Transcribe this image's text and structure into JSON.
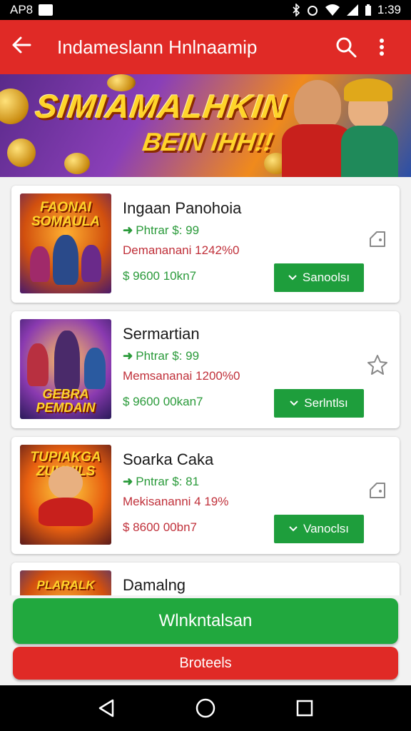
{
  "status_bar": {
    "carrier": "AP8",
    "time": "1:39"
  },
  "app_bar": {
    "title": "Indameslann Hnlnaamip"
  },
  "banner": {
    "headline": "SIMIAMALHKIN",
    "subline": "BEIN IHH!!"
  },
  "cards": [
    {
      "thumb_title": "FAONAI SOMAULA",
      "name": "Ingaan Panohoia",
      "price": "Phtrar $: 99",
      "demand": "Demananani 1242%0",
      "stock": "$ 9600 10kn7",
      "button_label": "Sanoolsı"
    },
    {
      "thumb_title": "GEBRA PEMDAIN",
      "name": "Sermartian",
      "price": "Phtrar $: 99",
      "demand": "Memsananai 1200%0",
      "stock": "$ 9600 00kan7",
      "button_label": "Serlntlsı"
    },
    {
      "thumb_title": "TUPIAKGA ZUKNILS",
      "name": "Soarka Caka",
      "price": "Pntrar $: 81",
      "demand": "Mekisananni 4 19%",
      "stock": "$ 8600 00bn7",
      "button_label": "Vanoclsı"
    },
    {
      "thumb_title": "PLARALK",
      "name": "Damalng",
      "price": "",
      "demand": "",
      "stock": "",
      "button_label": ""
    }
  ],
  "bottom": {
    "primary_label": "Wlnkntalsan",
    "secondary_label": "Broteels"
  },
  "colors": {
    "app_bar": "#e02a26",
    "green": "#1e9e3c",
    "red_text": "#c0303a"
  }
}
